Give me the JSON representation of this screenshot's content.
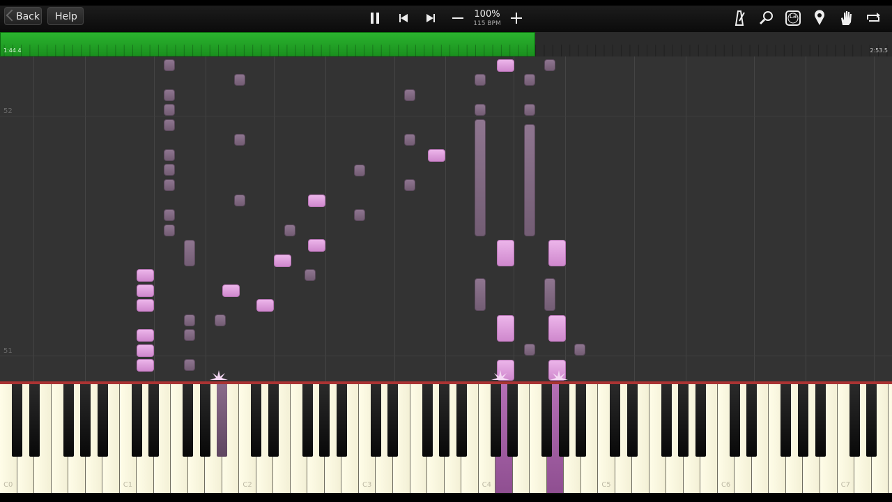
{
  "toolbar": {
    "back_label": "Back",
    "help_label": "Help",
    "zoom_percent": "100%",
    "tempo": "115 BPM",
    "icons": [
      "pause-icon",
      "previous-icon",
      "next-icon",
      "zoom-out-icon",
      "zoom-in-icon",
      "metronome-icon",
      "search-icon",
      "label-icon",
      "marker-icon",
      "hand-icon",
      "loop-icon"
    ],
    "label_icon_text": "La"
  },
  "progress": {
    "elapsed": "1:44.4",
    "total": "2:53.5",
    "fraction": 0.6,
    "fill_color": "#2bb52f"
  },
  "roll": {
    "measure_labels": [
      "52",
      "51"
    ]
  },
  "keyboard": {
    "octave_labels": [
      "C0",
      "C1",
      "C2",
      "C3",
      "C4",
      "C5",
      "C6",
      "C7"
    ]
  },
  "colors": {
    "pink_note": "#e2a6e0",
    "dark_note": "#7e6780",
    "background": "#333333"
  }
}
